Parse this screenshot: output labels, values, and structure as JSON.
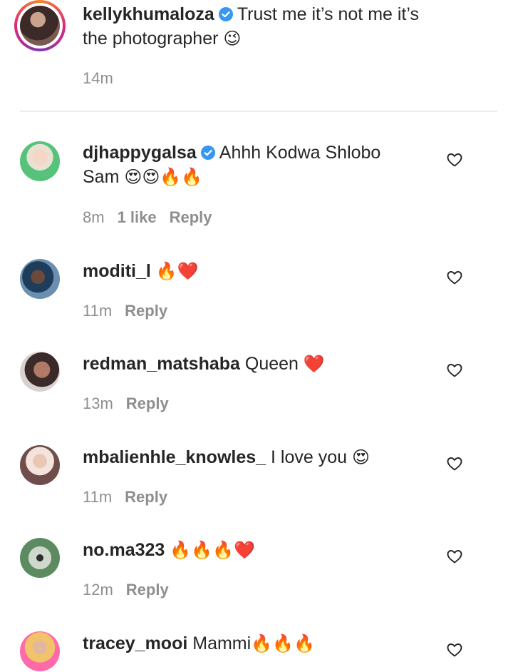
{
  "caption": {
    "username": "kellykhumaloza",
    "verified": true,
    "text_line1": "Trust me it’s not me it’s",
    "text_line2": "the photographer",
    "emoji": "😉",
    "time": "14m"
  },
  "comments": [
    {
      "username": "djhappygalsa",
      "verified": true,
      "text_line1": "Ahhh Kodwa Shlobo",
      "text_line2": "Sam",
      "emoji": "😍😍🔥🔥",
      "time": "8m",
      "likes": "1 like",
      "reply": "Reply"
    },
    {
      "username": "moditi_l",
      "text": "",
      "emoji": "🔥❤️",
      "time": "11m",
      "reply": "Reply"
    },
    {
      "username": "redman_matshaba",
      "text": "Queen",
      "emoji": "❤️",
      "time": "13m",
      "reply": "Reply"
    },
    {
      "username": "mbalienhle_knowles_",
      "text": "I love you",
      "emoji": "😍",
      "time": "11m",
      "reply": "Reply"
    },
    {
      "username": "no.ma323",
      "text": "",
      "emoji": "🔥🔥🔥❤️",
      "time": "12m",
      "reply": "Reply"
    },
    {
      "username": "tracey_mooi",
      "text": "Mammi",
      "emoji": "🔥🔥🔥",
      "time": "",
      "reply": ""
    }
  ],
  "icons": {
    "verified": "verified-badge-icon",
    "like": "heart-outline-icon"
  },
  "colors": {
    "verified": "#3897f0",
    "meta_text": "#8e8e8e"
  }
}
